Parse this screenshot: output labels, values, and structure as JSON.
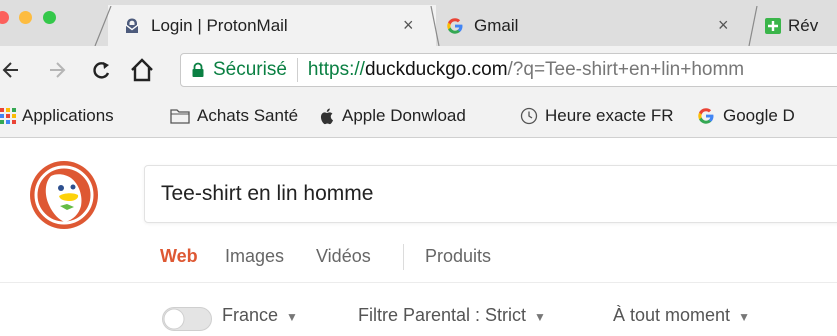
{
  "browser": {
    "colors": {
      "close": "#fc605c",
      "minimize": "#fdbc40",
      "maximize": "#34c84a",
      "secure": "#0b8043",
      "accent": "#de5833"
    },
    "tabs": [
      {
        "title": "Login | ProtonMail",
        "icon": "protonmail-icon",
        "active": true
      },
      {
        "title": "Gmail",
        "icon": "google-icon",
        "active": false
      },
      {
        "title": "Rév",
        "icon": "plus-app-icon",
        "active": false
      }
    ],
    "close_glyph": "×",
    "toolbar": {
      "secure_label": "Sécurisé",
      "url_scheme": "https://",
      "url_host": "duckduckgo.com",
      "url_rest": "/?q=Tee-shirt+en+lin+homm"
    },
    "bookmarks": [
      {
        "label": "Applications",
        "icon": "apps-grid-icon"
      },
      {
        "label": "Achats Santé",
        "icon": "folder-icon"
      },
      {
        "label": "Apple Donwload",
        "icon": "apple-icon"
      },
      {
        "label": "Heure exacte FR",
        "icon": "clock-icon"
      },
      {
        "label": "Google D",
        "icon": "google-icon"
      }
    ]
  },
  "search": {
    "query": "Tee-shirt en lin homme",
    "tabs": [
      "Web",
      "Images",
      "Vidéos",
      "Produits"
    ],
    "active_tab": "Web",
    "filters": {
      "region": "France",
      "safe_search": "Filtre Parental : Strict",
      "time": "À tout moment"
    },
    "caret": "▼"
  }
}
